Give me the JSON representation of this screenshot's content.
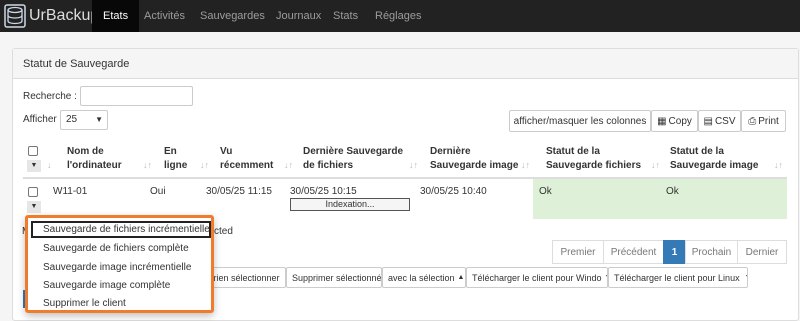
{
  "app": {
    "name": "UrBackup"
  },
  "nav": [
    {
      "label": "Etats",
      "active": true
    },
    {
      "label": "Activités"
    },
    {
      "label": "Sauvegardes"
    },
    {
      "label": "Journaux"
    },
    {
      "label": "Stats"
    },
    {
      "label": "Réglages"
    }
  ],
  "panel": {
    "title": "Statut de Sauvegarde"
  },
  "search": {
    "label": "Recherche :",
    "value": ""
  },
  "length": {
    "label": "Afficher",
    "value": "25"
  },
  "buttons": {
    "colvis": "afficher/masquer les colonnes",
    "copy": "Copy",
    "csv": "CSV",
    "print": "Print"
  },
  "columns": [
    "Nom de l'ordinateur",
    "En ligne",
    "Vu récemment",
    "Dernière Sauvegarde de fichiers",
    "Dernière Sauvegarde image",
    "Statut de la Sauvegarde fichiers",
    "Statut de la Sauvegarde image"
  ],
  "col_lines": {
    "name": [
      "Nom de",
      "l'ordinateur"
    ],
    "online": [
      "En",
      "ligne"
    ],
    "seen": [
      "Vu",
      "récemment"
    ],
    "file": [
      "Dernière Sauvegarde",
      "de fichiers"
    ],
    "image": [
      "Dernière",
      "Sauvegarde image"
    ],
    "fstatus": [
      "Statut de la",
      "Sauvegarde fichiers"
    ],
    "istatus": [
      "Statut de la",
      "Sauvegarde image"
    ]
  },
  "rows": [
    {
      "name": "W11-01",
      "online": "Oui",
      "seen": "30/05/25 11:15",
      "last_file": "30/05/25 10:15",
      "progress_label": "Indexation...",
      "last_image": "30/05/25 10:40",
      "file_status": "Ok",
      "image_status": "Ok"
    }
  ],
  "info": {
    "prefix": "M",
    "suffix": "cted"
  },
  "pagination": {
    "first": "Premier",
    "prev": "Précédent",
    "current": "1",
    "next": "Prochain",
    "last": "Dernier"
  },
  "actions": {
    "deselect": "e rien sélectionner",
    "delete_selected": "Supprimer sélectionnés",
    "with_selection": "avec la sélection",
    "download_windows": "Télécharger le client pour Windo",
    "download_linux": "Télécharger le client pour Linux"
  },
  "context_menu": {
    "items": [
      "Sauvegarde de fichiers incrémentielle",
      "Sauvegarde de fichiers complète",
      "Sauvegarde image incrémentielle",
      "Sauvegarde image complète",
      "Supprimer le client"
    ],
    "highlighted_index": 0,
    "highlight_color": "#f07c2b"
  },
  "colors": {
    "navbar": "#222222",
    "ok_row": "#dff0d8",
    "primary": "#337ab7"
  }
}
